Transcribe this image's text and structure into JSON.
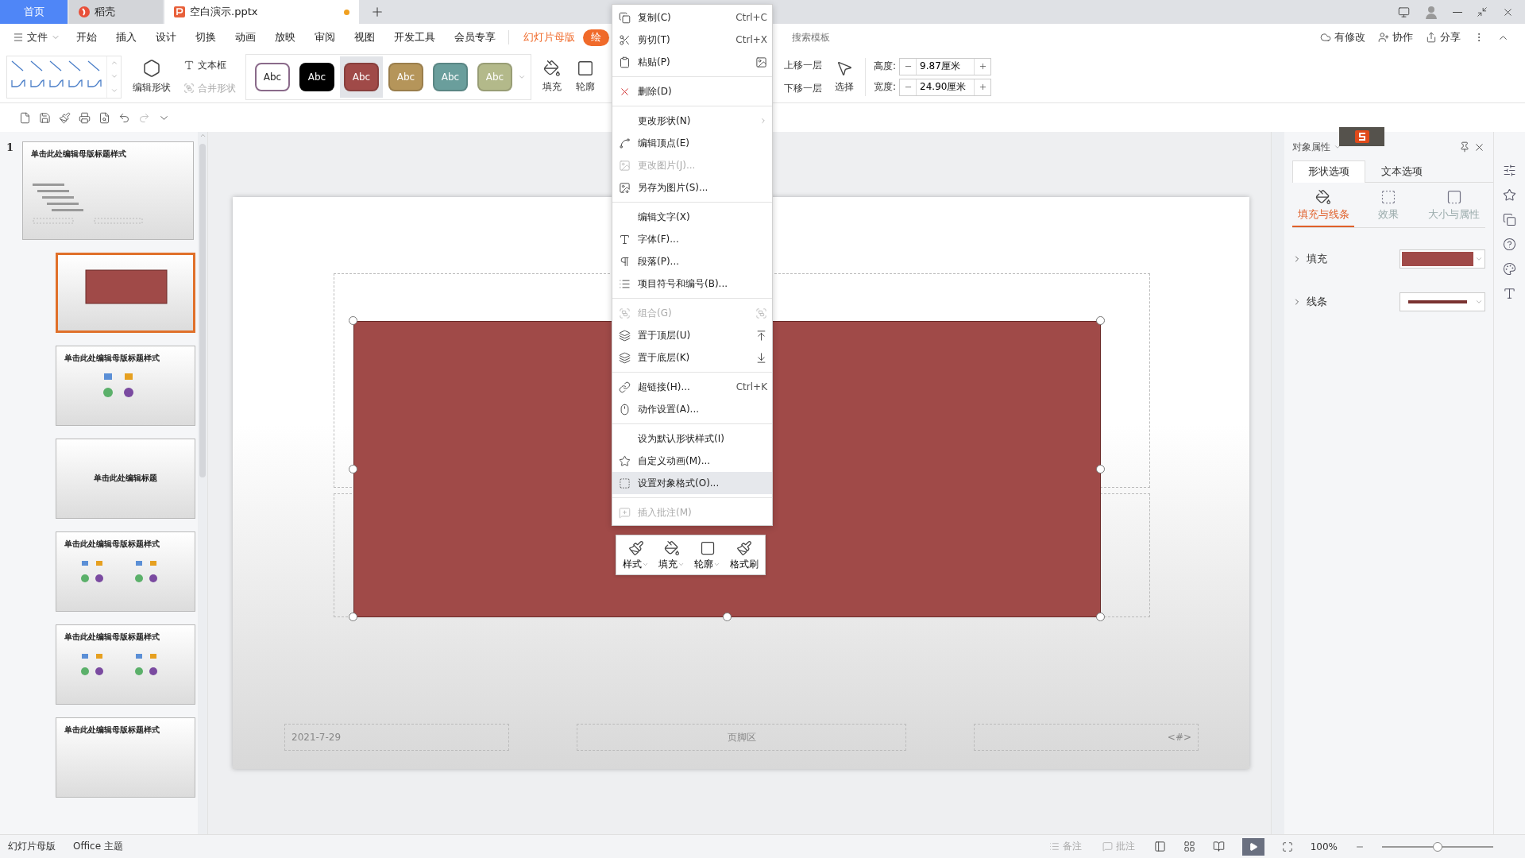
{
  "tabs": [
    {
      "label": "首页",
      "kind": "home",
      "selected": false
    },
    {
      "label": "稻壳",
      "kind": "docer",
      "selected": false
    },
    {
      "label": "空白演示.pptx",
      "kind": "doc",
      "selected": true,
      "modified": true
    }
  ],
  "menu": {
    "file": "文件",
    "items": [
      "开始",
      "插入",
      "设计",
      "切换",
      "动画",
      "放映",
      "审阅",
      "视图",
      "开发工具",
      "会员专享"
    ],
    "context_tabs": [
      {
        "label": "幻灯片母版",
        "selected": false
      },
      {
        "label": "绘",
        "selected": true
      }
    ],
    "search": "搜索模板",
    "actions": [
      "有修改",
      "协作",
      "分享"
    ]
  },
  "ribbon": {
    "edit_shape": "编辑形状",
    "text_box": "文本框",
    "merge_shape": "合并形状",
    "styles": [
      {
        "label": "Abc",
        "color": "#ffffff",
        "selected": false
      },
      {
        "label": "Abc",
        "color": "#000000",
        "selected": false
      },
      {
        "label": "Abc",
        "color": "#a04a48",
        "selected": true
      },
      {
        "label": "Abc",
        "color": "#b5955a",
        "selected": false
      },
      {
        "label": "Abc",
        "color": "#6a9e9c",
        "selected": false
      },
      {
        "label": "Abc",
        "color": "#b3b98a",
        "selected": false
      }
    ],
    "fill": "填充",
    "outline": "轮廓",
    "bring_forward": "上移一层",
    "send_backward": "下移一层",
    "select": "选择",
    "height": {
      "label": "高度:",
      "value": "9.87厘米"
    },
    "width": {
      "label": "宽度:",
      "value": "24.90厘米"
    }
  },
  "thumbnails": [
    {
      "number": "1",
      "kind": "master",
      "title": "单击此处编辑母版标题样式",
      "selected": false
    },
    {
      "kind": "shape",
      "selected": true
    },
    {
      "kind": "icons",
      "title": "单击此处编辑母版标题样式",
      "selected": false
    },
    {
      "kind": "title",
      "title": "单击此处编辑标题",
      "selected": false
    },
    {
      "kind": "two",
      "title": "单击此处编辑母版标题样式",
      "selected": false
    },
    {
      "kind": "two",
      "title": "单击此处编辑母版标题样式",
      "selected": false
    },
    {
      "kind": "plain",
      "title": "单击此处编辑母版标题样式",
      "selected": false
    }
  ],
  "slide": {
    "shape": {
      "color": "#a04a48",
      "selected": true
    },
    "footer": {
      "date": "2021-7-29",
      "center": "页脚区",
      "number": "<#>"
    }
  },
  "context_menu": [
    {
      "kind": "item",
      "label": "复制(C)",
      "shortcut": "Ctrl+C",
      "disabled": false,
      "selected": false,
      "submenu": false
    },
    {
      "kind": "item",
      "label": "剪切(T)",
      "shortcut": "Ctrl+X",
      "disabled": false,
      "selected": false
    },
    {
      "kind": "item",
      "label": "粘贴(P)",
      "disabled": false,
      "selected": false
    },
    {
      "kind": "separator"
    },
    {
      "kind": "item",
      "label": "删除(D)",
      "disabled": false,
      "selected": false
    },
    {
      "kind": "separator"
    },
    {
      "kind": "item",
      "label": "更改形状(N)",
      "submenu": true,
      "disabled": false,
      "selected": false
    },
    {
      "kind": "item",
      "label": "编辑顶点(E)",
      "disabled": false,
      "selected": false
    },
    {
      "kind": "item",
      "label": "更改图片(J)...",
      "disabled": true,
      "selected": false
    },
    {
      "kind": "item",
      "label": "另存为图片(S)...",
      "disabled": false,
      "selected": false
    },
    {
      "kind": "separator"
    },
    {
      "kind": "item",
      "label": "编辑文字(X)",
      "disabled": false,
      "selected": false
    },
    {
      "kind": "item",
      "label": "字体(F)...",
      "disabled": false,
      "selected": false
    },
    {
      "kind": "item",
      "label": "段落(P)...",
      "disabled": false,
      "selected": false
    },
    {
      "kind": "item",
      "label": "项目符号和编号(B)...",
      "disabled": false,
      "selected": false
    },
    {
      "kind": "separator"
    },
    {
      "kind": "item",
      "label": "组合(G)",
      "disabled": true,
      "selected": false
    },
    {
      "kind": "item",
      "label": "置于顶层(U)",
      "disabled": false,
      "selected": false
    },
    {
      "kind": "item",
      "label": "置于底层(K)",
      "disabled": false,
      "selected": false
    },
    {
      "kind": "separator"
    },
    {
      "kind": "item",
      "label": "超链接(H)...",
      "shortcut": "Ctrl+K",
      "disabled": false,
      "selected": false
    },
    {
      "kind": "item",
      "label": "动作设置(A)...",
      "disabled": false,
      "selected": false
    },
    {
      "kind": "separator"
    },
    {
      "kind": "item",
      "label": "设为默认形状样式(I)",
      "disabled": false,
      "selected": false
    },
    {
      "kind": "item",
      "label": "自定义动画(M)...",
      "disabled": false,
      "selected": false
    },
    {
      "kind": "item",
      "label": "设置对象格式(O)...",
      "disabled": false,
      "selected": true
    },
    {
      "kind": "separator"
    },
    {
      "kind": "item",
      "label": "插入批注(M)",
      "disabled": true,
      "selected": false
    }
  ],
  "mini_toolbar": [
    {
      "label": "样式",
      "dropdown": true
    },
    {
      "label": "填充",
      "dropdown": true
    },
    {
      "label": "轮廓",
      "dropdown": true
    },
    {
      "label": "格式刷",
      "dropdown": false
    }
  ],
  "panel": {
    "title": "对象属性",
    "tabs": [
      {
        "label": "形状选项",
        "selected": true
      },
      {
        "label": "文本选项",
        "selected": false
      }
    ],
    "subtabs": [
      {
        "label": "填充与线条",
        "selected": true
      },
      {
        "label": "效果",
        "selected": false
      },
      {
        "label": "大小与属性",
        "selected": false
      }
    ],
    "rows": [
      {
        "label": "填充",
        "kind": "fill",
        "color": "#a04a48"
      },
      {
        "label": "线条",
        "kind": "line",
        "color": "#7a3230"
      }
    ]
  },
  "status_bar": {
    "left": [
      "幻灯片母版",
      "Office 主题"
    ],
    "notes": "备注",
    "comments": "批注",
    "zoom": "100%",
    "zoom_slider": {
      "level": 0.5
    }
  }
}
